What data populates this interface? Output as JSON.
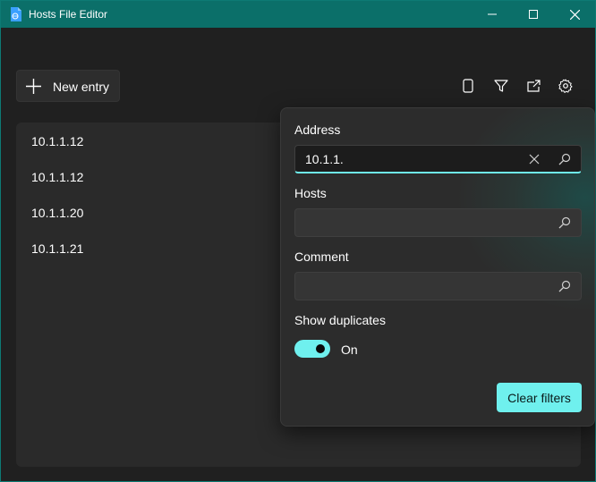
{
  "window": {
    "title": "Hosts File Editor",
    "accent": "#0b6f69"
  },
  "toolbar": {
    "new_entry_label": "New entry",
    "icons": [
      "phone-icon",
      "filter-icon",
      "export-icon",
      "gear-icon"
    ]
  },
  "entries": [
    {
      "address": "10.1.1.12"
    },
    {
      "address": "10.1.1.12"
    },
    {
      "address": "10.1.1.20"
    },
    {
      "address": "10.1.1.21"
    }
  ],
  "filter": {
    "address_label": "Address",
    "address_value": "10.1.1.",
    "hosts_label": "Hosts",
    "hosts_value": "",
    "comment_label": "Comment",
    "comment_value": "",
    "duplicates_label": "Show duplicates",
    "duplicates_state": "On",
    "duplicates_on": true,
    "clear_label": "Clear filters",
    "accent": "#6ff0ee"
  }
}
